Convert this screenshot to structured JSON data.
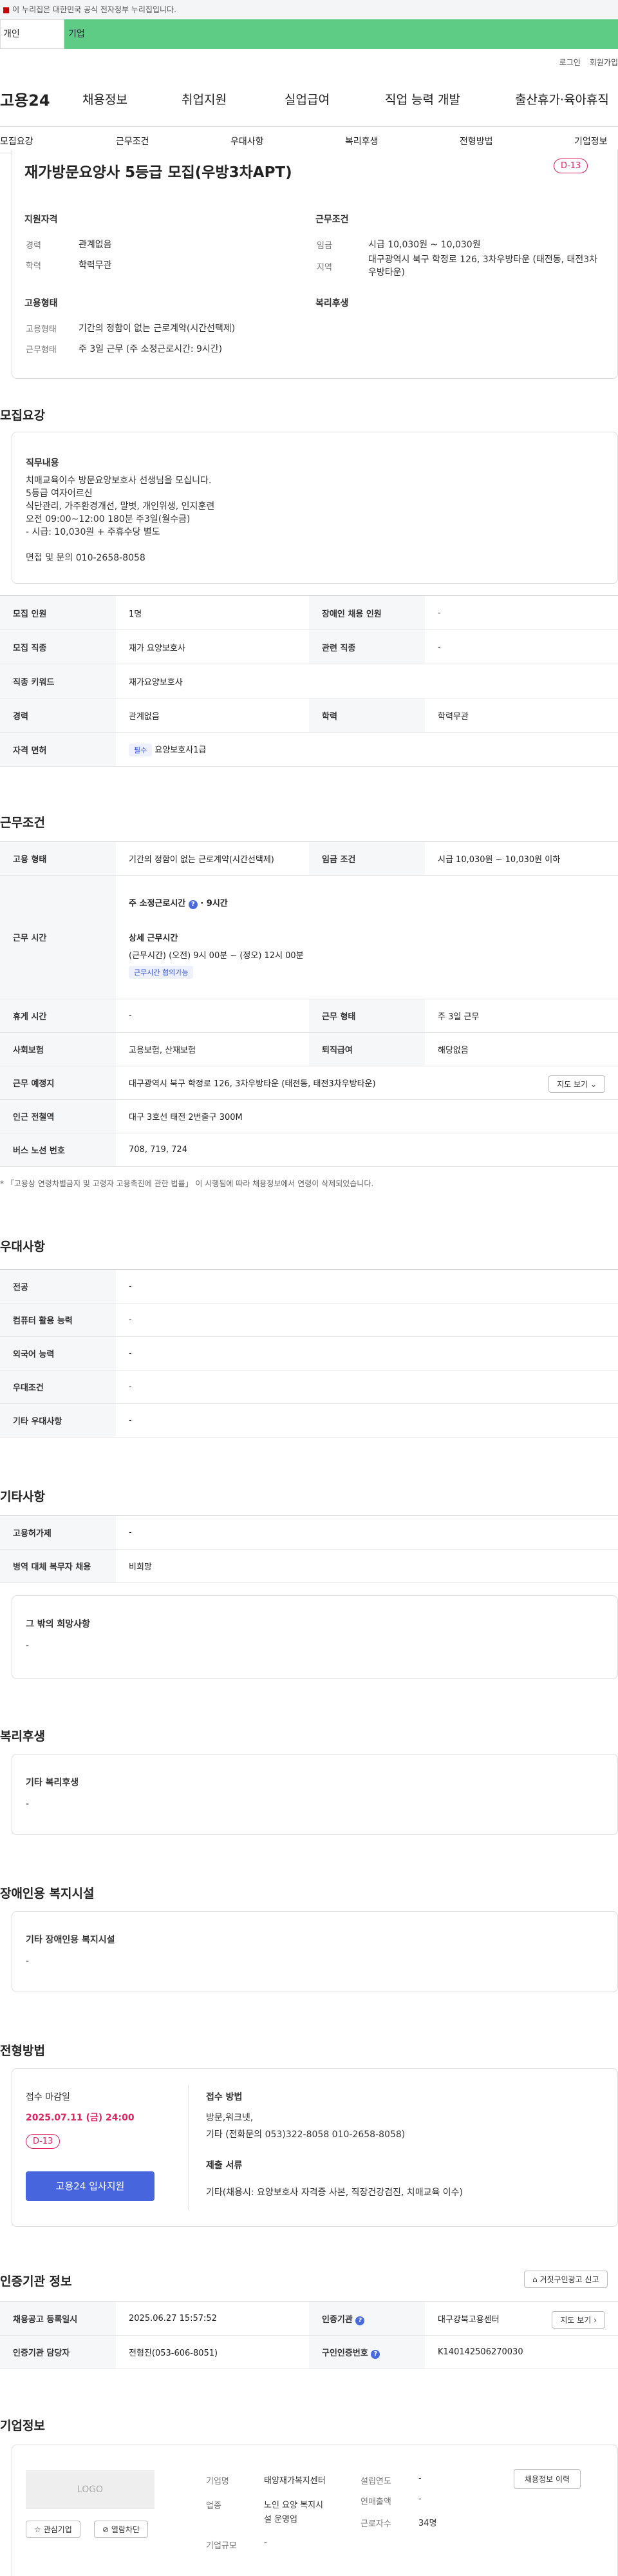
{
  "gov_banner": "이 누리집은 대한민국 공식 전자정부 누리집입니다.",
  "top_tabs": [
    "개인",
    "기업"
  ],
  "util_links": [
    "로그인",
    "회원가입"
  ],
  "logo": "고용24",
  "gnb": [
    "채용정보",
    "취업지원",
    "실업급여",
    "직업 능력 개발",
    "출산휴가·육아휴직"
  ],
  "anchors": [
    "모집요강",
    "근무조건",
    "우대사항",
    "복리후생",
    "전형방법",
    "기업정보"
  ],
  "job": {
    "title": "재가방문요양사 5등급 모집(우방3차APT)",
    "dday": "D-13",
    "qual_title": "지원자격",
    "career_k": "경력",
    "career_v": "관계없음",
    "edu_k": "학력",
    "edu_v": "학력무관",
    "cond_title": "근무조건",
    "wage_k": "임금",
    "wage_v": "시급 10,030원 ~ 10,030원",
    "area_k": "지역",
    "area_v": "대구광역시 북구 학정로 126, 3차우방타운 (태전동, 태전3차우방타운)",
    "emp_title": "고용형태",
    "emp_k": "고용형태",
    "emp_v": "기간의 정함이 없는 근로계약(시간선택제)",
    "work_k": "근무형태",
    "work_v": "주 3일 근무 (주 소정근로시간: 9시간)",
    "welfare_title": "복리후생"
  },
  "recruit": {
    "section": "모집요강",
    "content_title": "직무내용",
    "lines": [
      "치매교육이수 방문요양보호사 선생님을 모십니다.",
      "5등급 여자어르신",
      "식단관리, 가주환경개선, 말벗, 개인위생, 인지훈련",
      "오전 09:00~12:00 180분 주3일(월수금)",
      "- 시급: 10,030원 + 주휴수당 별도",
      "",
      "면접 및 문의 010-2658-8058"
    ],
    "rows": [
      {
        "k1": "모집 인원",
        "v1": "1명",
        "k2": "장애인 채용 인원",
        "v2": "-"
      },
      {
        "k1": "모집 직종",
        "v1": "재가 요양보호사",
        "k2": "관련 직종",
        "v2": "-"
      },
      {
        "k1": "직종 키워드",
        "v1": "재가요양보호사"
      },
      {
        "k1": "경력",
        "v1": "관계없음",
        "k2": "학력",
        "v2": "학력무관"
      },
      {
        "k1": "자격 면허",
        "chip": "필수",
        "v1": "요양보호사1급"
      }
    ]
  },
  "cond": {
    "section": "근무조건",
    "emp_k": "고용 형태",
    "emp_v": "기간의 정함이 없는 근로계약(시간선택제)",
    "wage_k": "임금 조건",
    "wage_v": "시급 10,030원 ~ 10,030원 이하",
    "time_k": "근무 시간",
    "weekly": "주 소정근로시간",
    "weekly_v": "9시간",
    "detail": "상세 근무시간",
    "detail_v": "(근무시간) (오전) 9시 00분 ~ (정오) 12시 00분",
    "chip": "근무시간 협의가능",
    "holiday_k": "휴게 시간",
    "holiday_v": "-",
    "wtype_k": "근무 형태",
    "wtype_v": "주 3일 근무",
    "ins_k": "사회보험",
    "ins_v": "고용보험, 산재보험",
    "ret_k": "퇴직급여",
    "ret_v": "해당없음",
    "place_k": "근무 예정지",
    "place_v": "대구광역시 북구 학정로 126, 3차우방타운 (태전동, 태전3차우방타운)",
    "map_btn": "지도 보기",
    "subway_k": "인근 전철역",
    "subway_v": "대구 3호선 태전 2번출구 300M",
    "bus_k": "버스 노선 번호",
    "bus_v": "708, 719, 724",
    "note": "* 「고용상 연령차별금지 및 고령자 고용촉진에 관한 법률」 이 시행됨에 따라 채용정보에서 연령이 삭제되었습니다."
  },
  "pref": {
    "section": "우대사항",
    "rows": [
      [
        "전공",
        "-"
      ],
      [
        "컴퓨터 활용 능력",
        "-"
      ],
      [
        "외국어 능력",
        "-"
      ],
      [
        "우대조건",
        "-"
      ],
      [
        "기타 우대사항",
        "-"
      ]
    ]
  },
  "etc": {
    "section": "기타사항",
    "rows": [
      [
        "고용허가제",
        "-"
      ],
      [
        "병역 대체 복무자 채용",
        "비희망"
      ]
    ],
    "hope_title": "그 밖의 희망사항",
    "hope_v": "-"
  },
  "welfare": {
    "section": "복리후생",
    "title": "기타 복리후생",
    "v": "-"
  },
  "disab": {
    "section": "장애인용 복지시설",
    "title": "기타 장애인용 복지시설",
    "v": "-"
  },
  "screen": {
    "section": "전형방법",
    "deadline_t": "접수 마감일",
    "deadline_v": "2025.07.11 (금) 24:00",
    "dday": "D-13",
    "apply_btn": "고용24 입사지원",
    "method_t": "접수 방법",
    "method_v1": "방문,워크넷,",
    "method_v2": "기타 (전화문의 053)322-8058 010-2658-8058)",
    "docs_t": "제출 서류",
    "docs_v": "기타(채용시: 요양보호사 자격증 사본, 직장건강검진, 치매교육 이수)"
  },
  "cert": {
    "section": "인증기관 정보",
    "report_btn": "거짓구인광고 신고",
    "reg_k": "채용공고 등록일시",
    "reg_v": "2025.06.27 15:57:52",
    "org_k": "인증기관",
    "org_v": "대구강북고용센터",
    "map_btn": "지도 보기",
    "mgr_k": "인증기관 담당자",
    "mgr_v": "전형진(053-606-8051)",
    "no_k": "구인인증번호",
    "no_v": "K140142506270030"
  },
  "company": {
    "section": "기업정보",
    "logo": "LOGO",
    "fav_btn": "관심기업",
    "block_btn": "열람차단",
    "name_k": "기업명",
    "name_v": "태양재가복지센터",
    "ind_k": "업종",
    "ind_v1": "노인 요양 복지시",
    "ind_v2": "설 운영업",
    "size_k": "기업규모",
    "size_v": "-",
    "year_k": "설립연도",
    "year_v": "-",
    "sales_k": "연매출액",
    "sales_v": "-",
    "staff_k": "근로자수",
    "staff_v": "34명",
    "hist_btn": "채용정보 이력"
  }
}
